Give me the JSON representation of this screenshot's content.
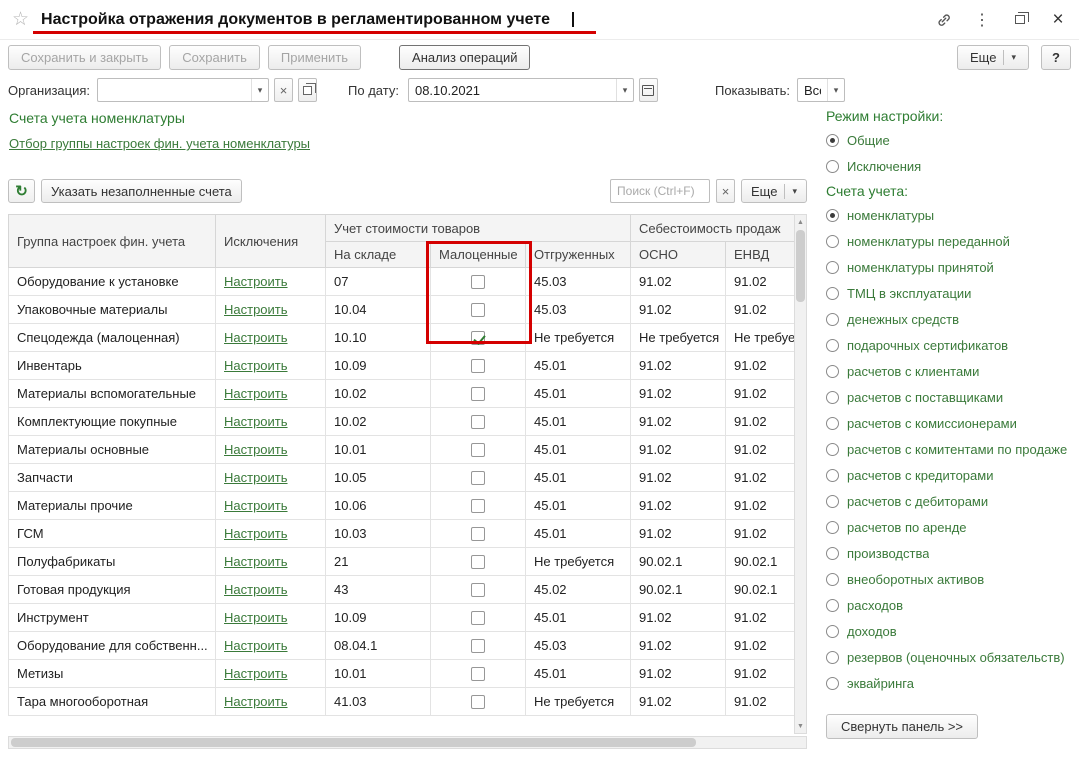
{
  "colors": {
    "green": "#2e7d32",
    "link": "#3a7a3a",
    "red": "#d40000",
    "muted": "#9e9e9e"
  },
  "icons": {
    "favorite": "☆",
    "kebab": "⋮",
    "close": "×",
    "dropdown": "▾",
    "refresh": "↻",
    "clear": "×",
    "scroll_up": "▲",
    "scroll_down": "▼"
  },
  "titlebar": {
    "title": "Настройка отражения документов в регламентированном учете"
  },
  "toolbar": {
    "save_and_close": "Сохранить и закрыть",
    "save": "Сохранить",
    "apply": "Применить",
    "analysis": "Анализ операций",
    "more": "Еще",
    "help": "?"
  },
  "filters": {
    "organization_label": "Организация:",
    "organization_value": "",
    "date_label": "По дату:",
    "date_value": "08.10.2021",
    "show_label": "Показывать:",
    "show_value": "Все"
  },
  "section": {
    "title": "Счета учета номенклатуры",
    "filter_link": "Отбор группы настроек фин. учета номенклатуры",
    "specify_button": "Указать незаполненные счета",
    "search_placeholder": "Поиск (Ctrl+F)",
    "more": "Еще"
  },
  "table": {
    "headers": {
      "group": "Группа настроек фин. учета",
      "exceptions": "Исключения",
      "goods_cost": "Учет стоимости товаров",
      "warehouse": "На складе",
      "low_value": "Малоценные",
      "shipped": "Отгруженных",
      "cost_of_sales": "Себестоимость продаж",
      "osno": "ОСНО",
      "envd": "ЕНВД"
    },
    "rows": [
      {
        "group": "Оборудование к установке",
        "configure": "Настроить",
        "warehouse": "07",
        "low_value": false,
        "shipped": "45.03",
        "osno": "91.02",
        "envd": "91.02"
      },
      {
        "group": "Упаковочные материалы",
        "configure": "Настроить",
        "warehouse": "10.04",
        "low_value": false,
        "shipped": "45.03",
        "osno": "91.02",
        "envd": "91.02"
      },
      {
        "group": "Спецодежда (малоценная)",
        "configure": "Настроить",
        "warehouse": "10.10",
        "low_value": true,
        "shipped": "Не требуется",
        "osno": "Не требуется",
        "envd": "Не требуется"
      },
      {
        "group": "Инвентарь",
        "configure": "Настроить",
        "warehouse": "10.09",
        "low_value": false,
        "shipped": "45.01",
        "osno": "91.02",
        "envd": "91.02"
      },
      {
        "group": "Материалы вспомогательные",
        "configure": "Настроить",
        "warehouse": "10.02",
        "low_value": false,
        "shipped": "45.01",
        "osno": "91.02",
        "envd": "91.02"
      },
      {
        "group": "Комплектующие покупные",
        "configure": "Настроить",
        "warehouse": "10.02",
        "low_value": false,
        "shipped": "45.01",
        "osno": "91.02",
        "envd": "91.02"
      },
      {
        "group": "Материалы основные",
        "configure": "Настроить",
        "warehouse": "10.01",
        "low_value": false,
        "shipped": "45.01",
        "osno": "91.02",
        "envd": "91.02"
      },
      {
        "group": "Запчасти",
        "configure": "Настроить",
        "warehouse": "10.05",
        "low_value": false,
        "shipped": "45.01",
        "osno": "91.02",
        "envd": "91.02"
      },
      {
        "group": "Материалы прочие",
        "configure": "Настроить",
        "warehouse": "10.06",
        "low_value": false,
        "shipped": "45.01",
        "osno": "91.02",
        "envd": "91.02"
      },
      {
        "group": "ГСМ",
        "configure": "Настроить",
        "warehouse": "10.03",
        "low_value": false,
        "shipped": "45.01",
        "osno": "91.02",
        "envd": "91.02"
      },
      {
        "group": "Полуфабрикаты",
        "configure": "Настроить",
        "warehouse": "21",
        "low_value": false,
        "shipped": "Не требуется",
        "osno": "90.02.1",
        "envd": "90.02.1"
      },
      {
        "group": "Готовая продукция",
        "configure": "Настроить",
        "warehouse": "43",
        "low_value": false,
        "shipped": "45.02",
        "osno": "90.02.1",
        "envd": "90.02.1"
      },
      {
        "group": "Инструмент",
        "configure": "Настроить",
        "warehouse": "10.09",
        "low_value": false,
        "shipped": "45.01",
        "osno": "91.02",
        "envd": "91.02"
      },
      {
        "group": "Оборудование для собственн...",
        "configure": "Настроить",
        "warehouse": "08.04.1",
        "low_value": false,
        "shipped": "45.03",
        "osno": "91.02",
        "envd": "91.02"
      },
      {
        "group": "Метизы",
        "configure": "Настроить",
        "warehouse": "10.01",
        "low_value": false,
        "shipped": "45.01",
        "osno": "91.02",
        "envd": "91.02"
      },
      {
        "group": "Тара многооборотная",
        "configure": "Настроить",
        "warehouse": "41.03",
        "low_value": false,
        "shipped": "Не требуется",
        "osno": "91.02",
        "envd": "91.02"
      }
    ]
  },
  "right_panel": {
    "mode_title": "Режим настройки:",
    "mode_options": [
      {
        "label": "Общие",
        "selected": true
      },
      {
        "label": "Исключения",
        "selected": false
      }
    ],
    "accounts_title": "Счета учета:",
    "account_options": [
      {
        "label": "номенклатуры",
        "selected": true
      },
      {
        "label": "номенклатуры переданной",
        "selected": false
      },
      {
        "label": "номенклатуры принятой",
        "selected": false
      },
      {
        "label": "ТМЦ в эксплуатации",
        "selected": false
      },
      {
        "label": "денежных средств",
        "selected": false
      },
      {
        "label": "подарочных сертификатов",
        "selected": false
      },
      {
        "label": "расчетов с клиентами",
        "selected": false
      },
      {
        "label": "расчетов с поставщиками",
        "selected": false
      },
      {
        "label": "расчетов с комиссионерами",
        "selected": false
      },
      {
        "label": "расчетов с комитентами по продаже",
        "selected": false
      },
      {
        "label": "расчетов с кредиторами",
        "selected": false
      },
      {
        "label": "расчетов с дебиторами",
        "selected": false
      },
      {
        "label": "расчетов по аренде",
        "selected": false
      },
      {
        "label": "производства",
        "selected": false
      },
      {
        "label": "внеоборотных активов",
        "selected": false
      },
      {
        "label": "расходов",
        "selected": false
      },
      {
        "label": "доходов",
        "selected": false
      },
      {
        "label": "резервов (оценочных обязательств)",
        "selected": false
      },
      {
        "label": "эквайринга",
        "selected": false
      }
    ],
    "collapse_button": "Свернуть панель >>"
  }
}
